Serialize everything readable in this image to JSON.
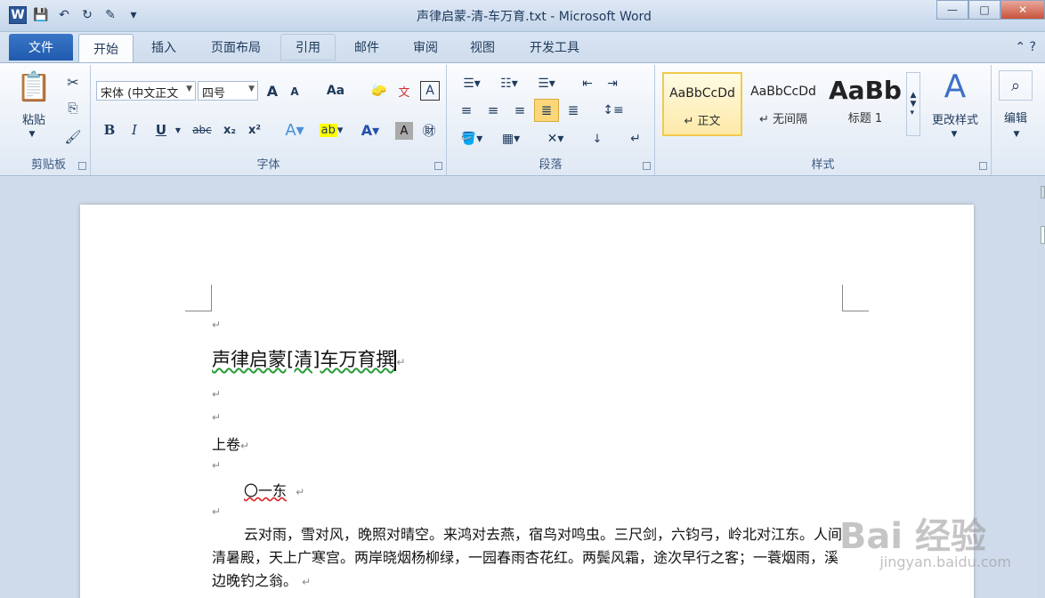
{
  "window": {
    "title": "声律启蒙-清-车万育.txt - Microsoft Word",
    "logo": "W",
    "min_icon": "minimize-icon",
    "max_icon": "maximize-icon",
    "close_glyph": "✕",
    "min_glyph": "—",
    "max_glyph": "□"
  },
  "tabs": {
    "file": "文件",
    "items": [
      "开始",
      "插入",
      "页面布局",
      "引用",
      "邮件",
      "审阅",
      "视图",
      "开发工具"
    ],
    "active": "开始"
  },
  "ribbon": {
    "clipboard": {
      "paste": "粘贴",
      "label": "剪贴板"
    },
    "font": {
      "name": "宋体 (中文正文",
      "size": "四号",
      "grow": "A",
      "shrink": "A",
      "change_case": "Aa",
      "bold": "B",
      "italic": "I",
      "underline": "U",
      "strike": "abc",
      "subscript": "x₂",
      "superscript": "x²",
      "label": "字体"
    },
    "paragraph": {
      "label": "段落"
    },
    "styles": {
      "items": [
        {
          "sample": "AaBbCcDd",
          "name": "↵ 正文"
        },
        {
          "sample": "AaBbCcDd",
          "name": "↵ 无间隔"
        },
        {
          "sample": "AaBb",
          "name": "标题 1"
        }
      ],
      "change": "更改样式",
      "label": "样式"
    },
    "editing": {
      "label": "编辑"
    }
  },
  "document": {
    "title": "声律启蒙[清]车万育撰",
    "section": "上卷",
    "chapter": "〇一东",
    "body": "云对雨，雪对风，晚照对晴空。来鸿对去燕，宿鸟对鸣虫。三尺剑，六钧弓，岭北对江东。人间清暑殿，天上广寒宫。两岸晓烟杨柳绿，一园春雨杏花红。两鬓风霜，途次早行之客；一蓑烟雨，溪边晚钓之翁。",
    "para_mark": "↵"
  },
  "watermark": {
    "main": "Bai 经验",
    "sub": "jingyan.baidu.com"
  }
}
